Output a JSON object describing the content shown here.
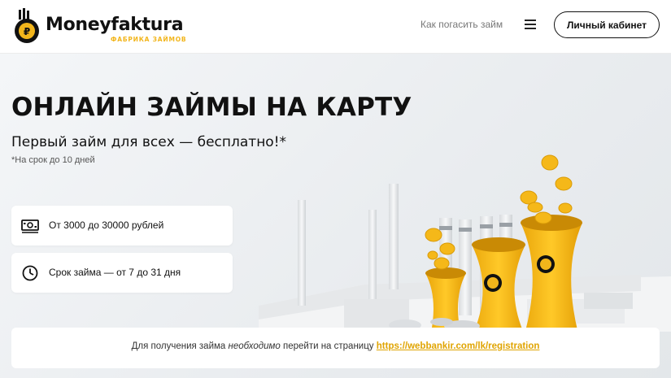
{
  "header": {
    "logo_name": "Moneyfaktura",
    "logo_sub": "ФАБРИКА ЗАЙМОВ",
    "nav_link": "Как погасить займ",
    "menu_icon": "hamburger-icon",
    "cabinet_button": "Личный кабинет"
  },
  "hero": {
    "title": "ОНЛАЙН ЗАЙМЫ НА КАРТУ",
    "subtitle": "Первый займ для всех — бесплатно!*",
    "note": "*На срок до 10 дней",
    "features": [
      {
        "icon": "cash-icon",
        "text": "От 3000 до 30000 рублей"
      },
      {
        "icon": "clock-icon",
        "text": "Срок займа — от 7 до 31 дня"
      }
    ],
    "illustration": "factory-with-coins-illustration"
  },
  "info": {
    "prefix": "Для получения займа ",
    "emphasis": "необходимо",
    "middle": " перейти на страницу ",
    "link": "https://webbankir.com/lk/registration"
  },
  "colors": {
    "accent": "#f2b51b",
    "link": "#e0a400",
    "text": "#111111",
    "background": "#eef1f3"
  }
}
